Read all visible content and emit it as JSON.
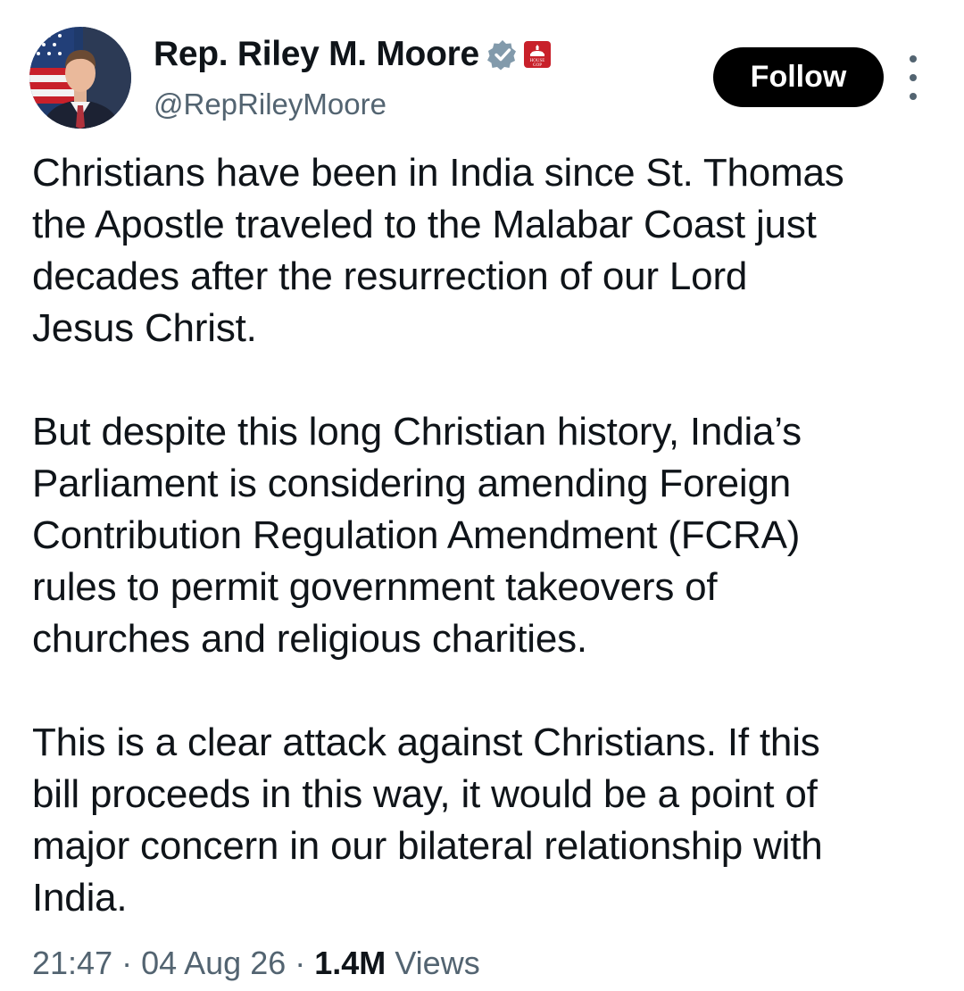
{
  "author": {
    "display_name": "Rep. Riley M. Moore",
    "handle": "@RepRileyMoore",
    "verified_icon": "verified-badge-icon",
    "affiliate_icon": "house-gop-badge-icon",
    "affiliate_badge_text": "HOUSE GOP",
    "avatar": "portrait-with-american-flag"
  },
  "actions": {
    "follow_label": "Follow",
    "more_icon": "more-options-icon"
  },
  "tweet": {
    "paragraphs": [
      "Christians have been in India since St. Thomas\nthe Apostle traveled to the Malabar Coast just\ndecades after the resurrection of our Lord\nJesus Christ.",
      "But despite this long Christian history, India’s\nParliament is considering amending Foreign\nContribution Regulation Amendment (FCRA)\nrules to permit government takeovers of\nchurches and religious charities.",
      "This is a clear attack against Christians. If this\nbill proceeds in this way, it would be a point of\nmajor concern in our bilateral relationship with\nIndia."
    ]
  },
  "meta": {
    "time": "21:47",
    "separator": "·",
    "date": "04 Aug 26",
    "views_count": "1.4M",
    "views_label": "Views"
  },
  "colors": {
    "text": "#0f1419",
    "secondary": "#536471",
    "button_bg": "#000000",
    "verified": "#829aab",
    "affiliate": "#c8202a"
  }
}
